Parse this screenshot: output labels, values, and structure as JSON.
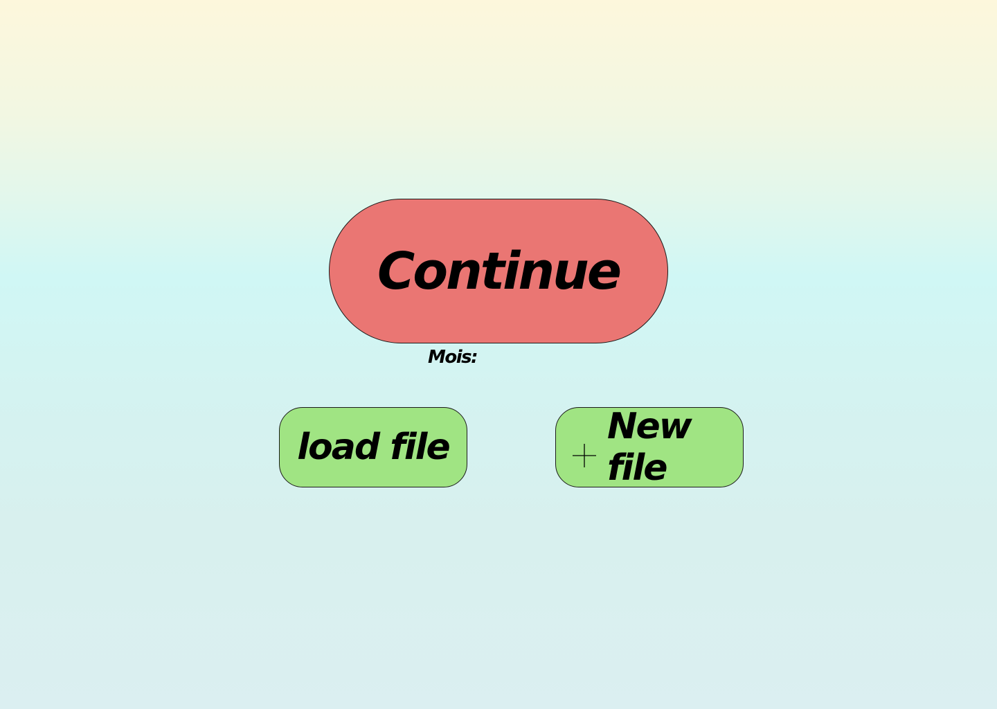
{
  "main": {
    "continue_label": "Continue",
    "mois_label": "Mois:",
    "mois_value": "",
    "load_file_label": "load file",
    "new_file_label": "New file",
    "new_file_icon": "plus-icon"
  },
  "colors": {
    "continue_bg": "#ea7673",
    "file_buttons_bg": "#a0e483",
    "text": "#000000"
  }
}
